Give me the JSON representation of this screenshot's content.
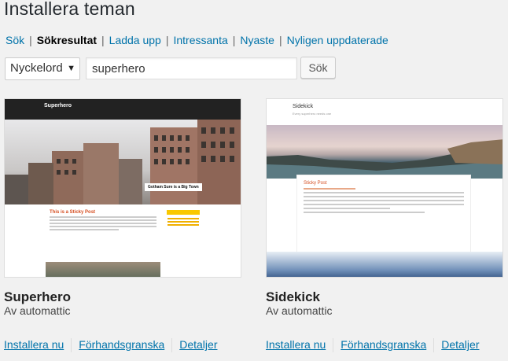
{
  "page": {
    "title": "Installera teman"
  },
  "subnav": {
    "items": [
      {
        "label": "Sök"
      },
      {
        "label": "Sökresultat",
        "current": true
      },
      {
        "label": "Ladda upp"
      },
      {
        "label": "Intressanta"
      },
      {
        "label": "Nyaste"
      },
      {
        "label": "Nyligen uppdaterade"
      }
    ]
  },
  "search": {
    "type_selected": "Nyckelord",
    "query": "superhero",
    "button_label": "Sök"
  },
  "themes": [
    {
      "name": "Superhero",
      "author": "Av automattic",
      "install_label": "Installera nu",
      "preview_label": "Förhandsgranska",
      "details_label": "Detaljer",
      "screenshot": {
        "site_title": "Superhero",
        "banner_caption": "Gotham Sure is a Big Town",
        "post_title": "This is a Sticky Post"
      }
    },
    {
      "name": "Sidekick",
      "author": "Av automattic",
      "install_label": "Installera nu",
      "preview_label": "Förhandsgranska",
      "details_label": "Detaljer",
      "screenshot": {
        "site_title": "Sidekick",
        "tagline": "Every superhero needs one",
        "post_title": "Sticky Post"
      }
    }
  ],
  "colors": {
    "link": "#0073aa",
    "background": "#f1f1f1",
    "accent_orange": "#d54e21"
  }
}
